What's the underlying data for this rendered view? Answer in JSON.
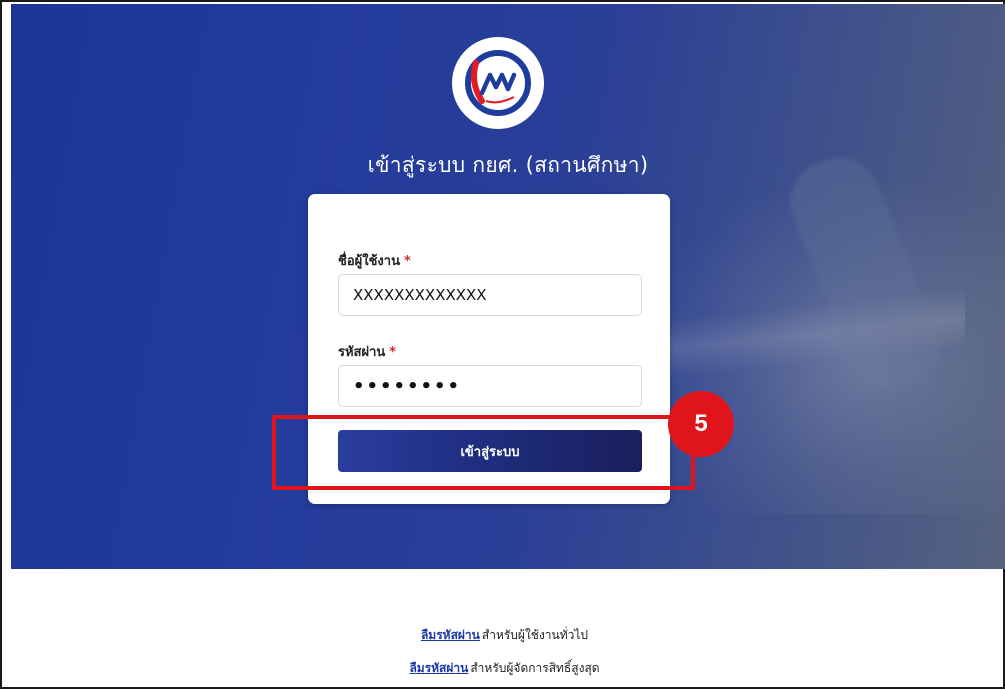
{
  "header": {
    "title": "เข้าสู่ระบบ กยศ. (สถานศึกษา)"
  },
  "logo": {
    "icon": "gsl-fund-logo"
  },
  "form": {
    "username_label": "ชื่อผู้ใช้งาน",
    "username_value": "XXXXXXXXXXXXX",
    "password_label": "รหัสผ่าน",
    "password_value": "••••••••",
    "required_mark": "*",
    "login_button": "เข้าสู่ระบบ"
  },
  "annotation": {
    "step_number": "5",
    "color": "#e0151b"
  },
  "footer": {
    "links": [
      {
        "link_text": "ลืมรหัสผ่าน",
        "suffix": "สำหรับผู้ใช้งานทั่วไป"
      },
      {
        "link_text": "ลืมรหัสผ่าน",
        "suffix": "สำหรับผู้จัดการสิทธิ์สูงสุด"
      }
    ]
  },
  "colors": {
    "hero_blue": "#1c3596",
    "button": "#1e2b7a",
    "link": "#1b3aa8",
    "required": "#d62828"
  }
}
